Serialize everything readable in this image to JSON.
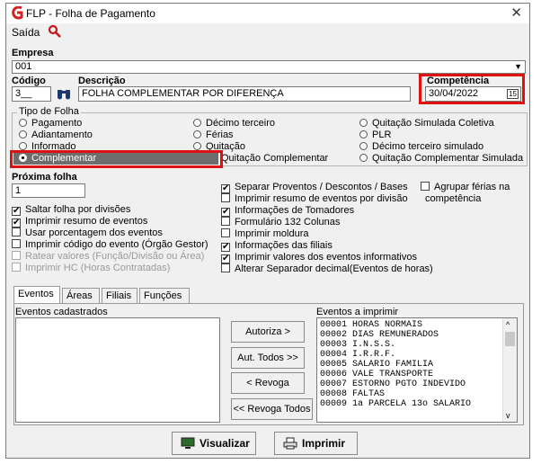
{
  "window": {
    "title": "FLP - Folha de Pagamento",
    "close_label": "✕"
  },
  "menu": {
    "saida": "Saída"
  },
  "empresa": {
    "label": "Empresa",
    "value": "001"
  },
  "codigo": {
    "label": "Código",
    "value": "3__"
  },
  "descricao": {
    "label": "Descrição",
    "value": "FOLHA COMPLEMENTAR POR DIFERENÇA"
  },
  "competencia": {
    "label": "Competência",
    "value": "30/04/2022",
    "calendar_icon_text": "15"
  },
  "tipo_folha": {
    "legend": "Tipo de Folha",
    "options": [
      "Pagamento",
      "Adiantamento",
      "Informado",
      "Complementar",
      "Décimo terceiro",
      "Férias",
      "Quitação",
      "Quitação Complementar",
      "Quitação Simulada Coletiva",
      "PLR",
      "Décimo terceiro simulado",
      "Quitação Complementar Simulada"
    ],
    "selected": "Complementar"
  },
  "proxima_folha": {
    "label": "Próxima folha",
    "value": "1"
  },
  "options_left": [
    {
      "label": "Saltar folha por divisões",
      "checked": true
    },
    {
      "label": "Imprimir resumo de eventos",
      "checked": true
    },
    {
      "label": "Usar porcentagem dos eventos",
      "checked": false
    },
    {
      "label": "Imprimir código do evento (Órgão Gestor)",
      "checked": false
    },
    {
      "label": "Ratear valores (Função/Divisão ou Área)",
      "checked": false
    },
    {
      "label": "Imprimir HC (Horas Contratadas)",
      "checked": false
    }
  ],
  "options_right": [
    {
      "label": "Separar Proventos / Descontos / Bases",
      "checked": true
    },
    {
      "label": "Imprimir resumo de eventos por divisão",
      "checked": false
    },
    {
      "label": "Informações de Tomadores",
      "checked": true
    },
    {
      "label": "Formulário 132 Colunas",
      "checked": false
    },
    {
      "label": "Imprimir moldura",
      "checked": false
    },
    {
      "label": "Informações das filiais",
      "checked": true
    },
    {
      "label": "Imprimir valores dos eventos informativos",
      "checked": true
    },
    {
      "label": "Alterar Separador decimal(Eventos de horas)",
      "checked": false
    }
  ],
  "agrupar_ferias": {
    "label_line1": "Agrupar férias na",
    "label_line2": "competência",
    "checked": false
  },
  "tabs": [
    "Eventos",
    "Áreas",
    "Filiais",
    "Funções"
  ],
  "eventos_cadastrados": {
    "label": "Eventos cadastrados"
  },
  "eventos_imprimir": {
    "label": "Eventos a imprimir",
    "items": [
      "00001 HORAS NORMAIS",
      "00002 DIAS REMUNERADOS",
      "00003 I.N.S.S.",
      "00004 I.R.R.F.",
      "00005 SALARIO FAMILIA",
      "00006 VALE TRANSPORTE",
      "00007 ESTORNO PGTO INDEVIDO",
      "00008 FALTAS",
      "00009 1a PARCELA 13o SALARIO"
    ]
  },
  "transfer_buttons": {
    "autoriza": "Autoriza >",
    "aut_todos": "Aut. Todos >>",
    "revoga": "< Revoga",
    "revoga_todos": "<< Revoga Todos"
  },
  "bottom_buttons": {
    "visualizar": "Visualizar",
    "imprimir": "Imprimir"
  },
  "colors": {
    "highlight_red": "#e01010",
    "logo_red": "#d42020"
  }
}
